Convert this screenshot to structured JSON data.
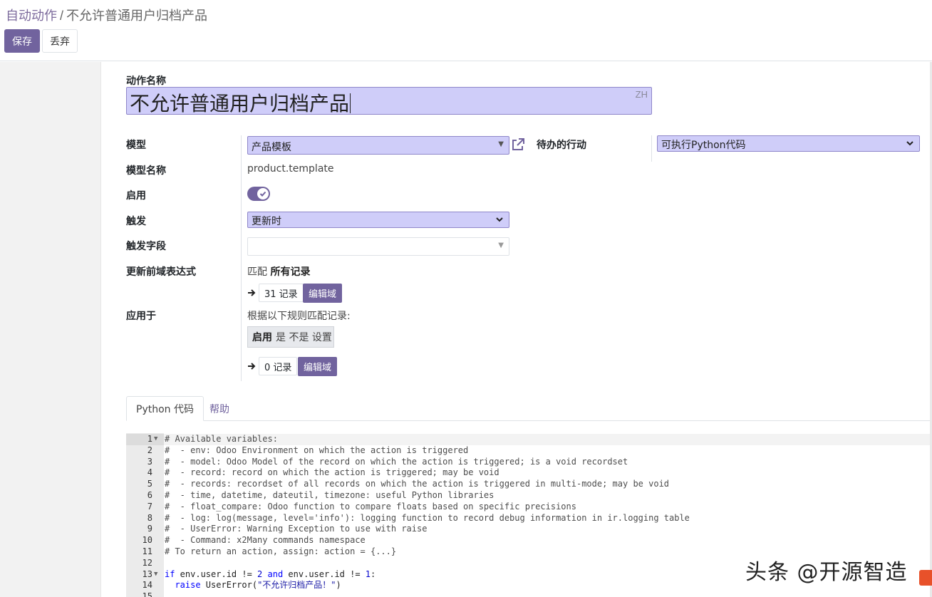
{
  "breadcrumb": {
    "parent": "自动动作",
    "separator": "/",
    "current": "不允许普通用户归档产品"
  },
  "toolbar": {
    "save_label": "保存",
    "discard_label": "丢弃"
  },
  "form": {
    "name_label": "动作名称",
    "name_value": "不允许普通用户归档产品",
    "lang_badge": "ZH",
    "model_label": "模型",
    "model_value": "产品模板",
    "model_name_label": "模型名称",
    "model_name_value": "product.template",
    "active_label": "启用",
    "active_value": true,
    "trigger_label": "触发",
    "trigger_value": "更新时",
    "trigger_fields_label": "触发字段",
    "trigger_fields_value": "",
    "pre_domain_label": "更新前域表达式",
    "pre_domain_prefix": "匹配",
    "pre_domain_match": "所有记录",
    "pre_domain_count": "31 记录",
    "edit_domain_label": "编辑域",
    "apply_on_label": "应用于",
    "apply_on_desc": "根据以下规则匹配记录:",
    "rule_field": "启用",
    "rule_text": "是 不是 设置",
    "apply_count": "0 记录",
    "todo_action_label": "待办的行动",
    "todo_action_value": "可执行Python代码"
  },
  "tabs": [
    {
      "label": "Python 代码"
    },
    {
      "label": "帮助"
    }
  ],
  "code": {
    "lines": [
      {
        "n": "1",
        "fold": true,
        "text": "# Available variables:"
      },
      {
        "n": "2",
        "text": "#  - env: Odoo Environment on which the action is triggered"
      },
      {
        "n": "3",
        "text": "#  - model: Odoo Model of the record on which the action is triggered; is a void recordset"
      },
      {
        "n": "4",
        "text": "#  - record: record on which the action is triggered; may be void"
      },
      {
        "n": "5",
        "text": "#  - records: recordset of all records on which the action is triggered in multi-mode; may be void"
      },
      {
        "n": "6",
        "text": "#  - time, datetime, dateutil, timezone: useful Python libraries"
      },
      {
        "n": "7",
        "text": "#  - float_compare: Odoo function to compare floats based on specific precisions"
      },
      {
        "n": "8",
        "text": "#  - log: log(message, level='info'): logging function to record debug information in ir.logging table"
      },
      {
        "n": "9",
        "text": "#  - UserError: Warning Exception to use with raise"
      },
      {
        "n": "10",
        "text": "#  - Command: x2Many commands namespace"
      },
      {
        "n": "11",
        "text": "# To return an action, assign: action = {...}"
      },
      {
        "n": "12",
        "text": ""
      },
      {
        "n": "13",
        "fold": true,
        "text": "if env.user.id != 2 and env.user.id != 1:"
      },
      {
        "n": "14",
        "text": "  raise UserError(\"不允许归档产品！\")"
      },
      {
        "n": "15",
        "text": ""
      }
    ]
  },
  "watermark": "头条 @开源智造",
  "colors": {
    "primary": "#71639e",
    "input_bg": "#cfcdf9",
    "input_border": "#8f87c9"
  }
}
